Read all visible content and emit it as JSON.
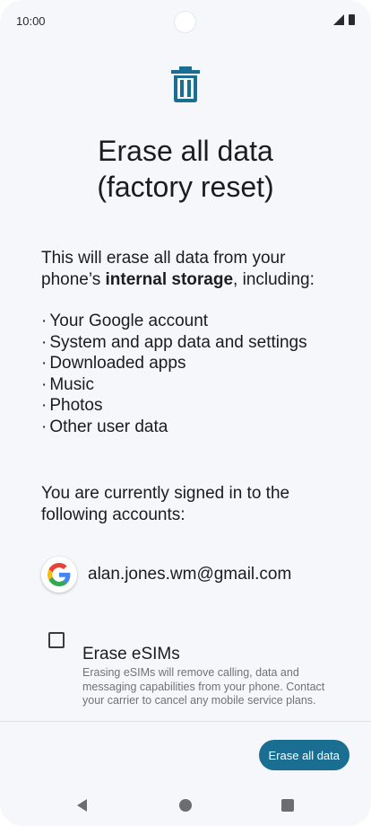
{
  "status_bar": {
    "time": "10:00"
  },
  "screen": {
    "title_line1": "Erase all data",
    "title_line2": "(factory reset)",
    "intro_prefix": "This will erase all data from your phone’s ",
    "intro_bold": "internal storage",
    "intro_suffix": ", including:",
    "data_items": [
      "Your Google account",
      "System and app data and settings",
      "Downloaded apps",
      "Music",
      "Photos",
      "Other user data"
    ],
    "accounts_intro": "You are currently signed in to the following accounts:",
    "account_email": "alan.jones.wm@gmail.com",
    "esim": {
      "title": "Erase eSIMs",
      "description": "Erasing eSIMs will remove calling, data and messaging capabilities from your phone. Contact your carrier to cancel any mobile service plans.",
      "checked": false
    },
    "erase_button_label": "Erase all data"
  },
  "colors": {
    "accent": "#1a6e92",
    "icon": "#1a6e92"
  },
  "icons": [
    "trash-icon",
    "google-icon",
    "signal-icon",
    "battery-icon",
    "back-icon",
    "home-icon",
    "recents-icon"
  ]
}
